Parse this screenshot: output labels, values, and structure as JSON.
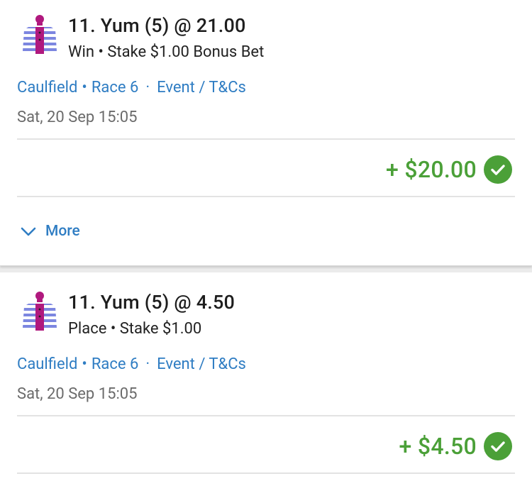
{
  "bets": [
    {
      "title": "11. Yum (5) @ 21.00",
      "subtitle": "Win • Stake $1.00 Bonus Bet",
      "venue": "Caulfield",
      "race": "Race 6",
      "event": "Event / T&Cs",
      "datetime": "Sat, 20 Sep 15:05",
      "payout": "+ $20.00",
      "more_label": "More"
    },
    {
      "title": "11. Yum (5) @ 4.50",
      "subtitle": "Place • Stake $1.00",
      "venue": "Caulfield",
      "race": "Race 6",
      "event": "Event / T&Cs",
      "datetime": "Sat, 20 Sep 15:05",
      "payout": "+ $4.50"
    }
  ],
  "colors": {
    "link": "#2f7dc3",
    "win_green": "#4ba038",
    "silk_magenta": "#b0197e",
    "silk_blue": "#7c86e0"
  },
  "icons": {
    "silk": "jockey-silk-icon",
    "settled": "check-circle-icon",
    "more": "chevron-down-icon"
  }
}
